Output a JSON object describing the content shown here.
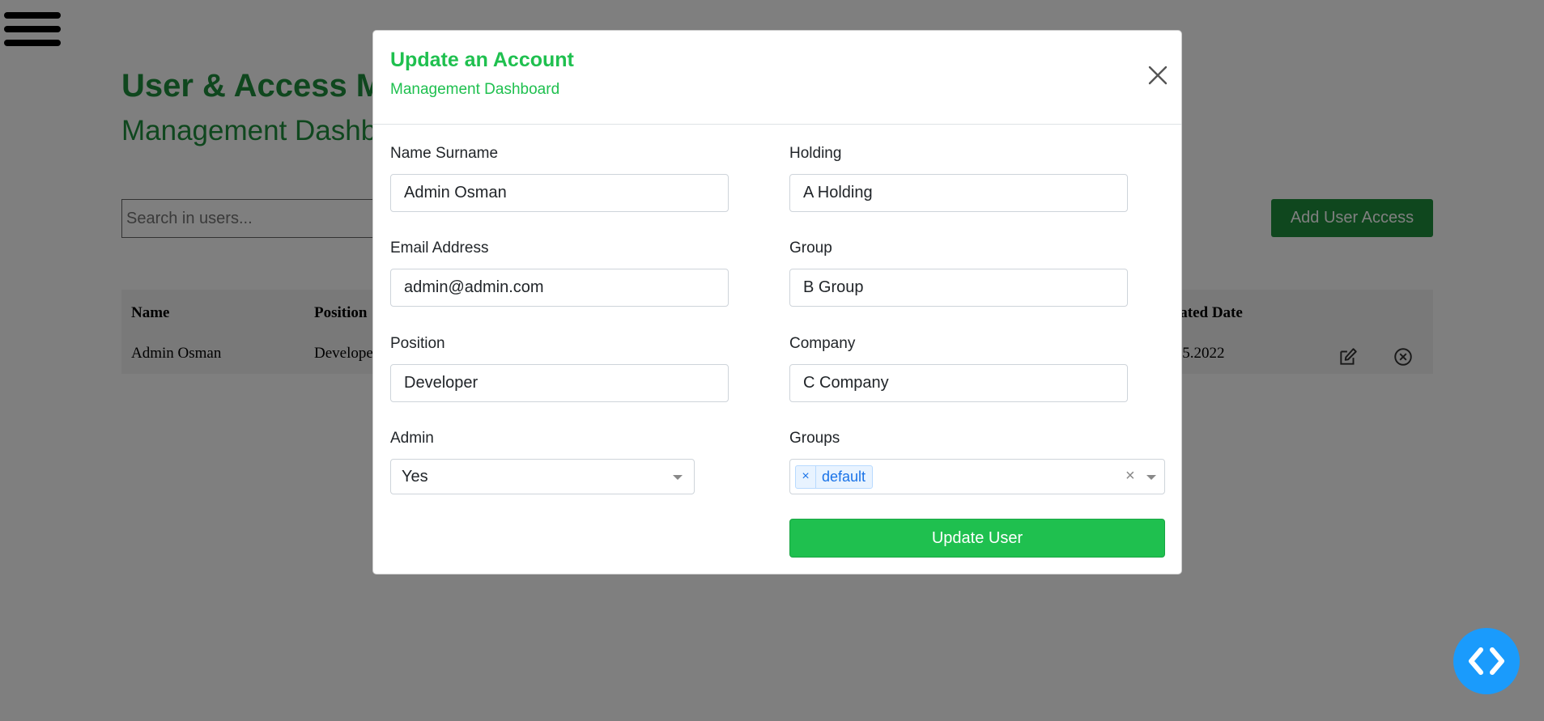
{
  "page": {
    "title": "User & Access Management",
    "subtitle": "Management Dashboard",
    "search_placeholder": "Search in users...",
    "add_button": "Add User Access",
    "table": {
      "headers": [
        "Name",
        "Position",
        "Created Date"
      ],
      "row": [
        "Admin Osman",
        "Developer",
        "12.05.2022"
      ]
    }
  },
  "modal": {
    "title": "Update an Account",
    "subtitle": "Management Dashboard",
    "fields": {
      "name_label": "Name Surname",
      "name_value": "Admin Osman",
      "email_label": "Email Address",
      "email_value": "admin@admin.com",
      "position_label": "Position",
      "position_value": "Developer",
      "admin_label": "Admin",
      "admin_value": "Yes",
      "holding_label": "Holding",
      "holding_value": "A Holding",
      "group_label": "Group",
      "group_value": "B Group",
      "company_label": "Company",
      "company_value": "C Company",
      "groups_label": "Groups",
      "groups_tags": [
        "default"
      ]
    },
    "update_button": "Update User"
  },
  "colors": {
    "brand_green": "#1e8f3c",
    "modal_green": "#1fc04f",
    "fab_blue": "#1a9bfc"
  },
  "icons": [
    "hamburger-icon",
    "edit-icon",
    "delete-icon",
    "close-icon",
    "code-icon"
  ]
}
